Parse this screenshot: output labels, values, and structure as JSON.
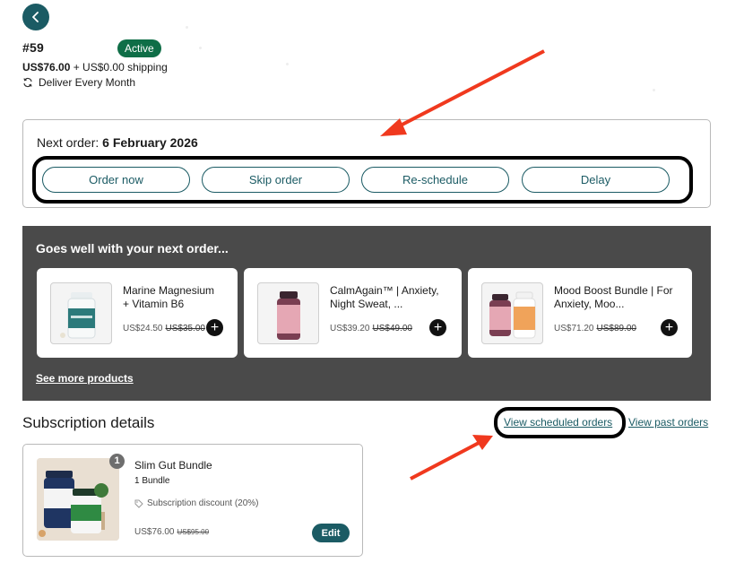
{
  "header": {
    "order_id": "#59",
    "status": "Active",
    "price": "US$76.00",
    "shipping": " + US$0.00 shipping",
    "frequency": "Deliver Every Month"
  },
  "next_order": {
    "label": "Next order: ",
    "date": "6 February 2026",
    "actions": [
      "Order now",
      "Skip order",
      "Re-schedule",
      "Delay"
    ]
  },
  "upsell": {
    "title": "Goes well with your next order...",
    "products": [
      {
        "name": "Marine Magnesium\n+ Vitamin B6",
        "price": "US$24.50",
        "old_price": "US$35.00"
      },
      {
        "name": "CalmAgain™ | Anxiety,\nNight Sweat, ...",
        "price": "US$39.20",
        "old_price": "US$49.00"
      },
      {
        "name": "Mood Boost Bundle | For\nAnxiety, Moo...",
        "price": "US$71.20",
        "old_price": "US$89.00"
      }
    ],
    "see_more": "See more products"
  },
  "subscription": {
    "title": "Subscription details",
    "view_scheduled": "View scheduled orders",
    "view_past": "View past orders",
    "item": {
      "qty": "1",
      "name": "Slim Gut Bundle",
      "bundle": "1 Bundle",
      "discount": "Subscription discount (20%)",
      "price": "US$76.00",
      "old_price": "US$95.00",
      "edit": "Edit"
    }
  },
  "colors": {
    "accent": "#1b5b64",
    "status_green": "#0f6e47",
    "panel": "#4a4a4a",
    "annotation_arrow": "#f0391e"
  }
}
